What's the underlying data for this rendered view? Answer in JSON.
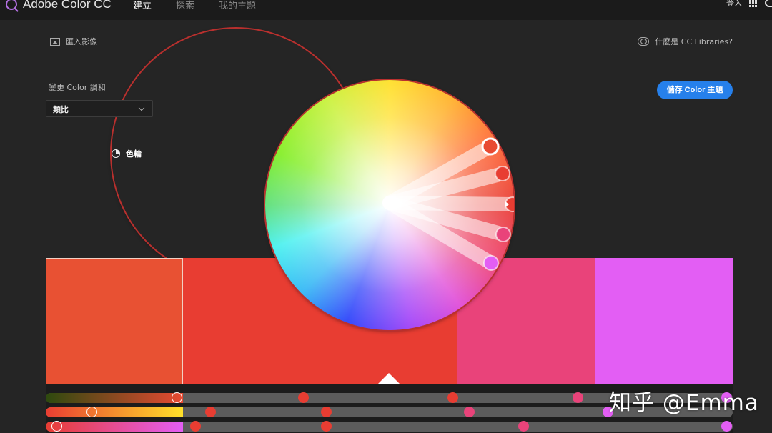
{
  "app": {
    "title": "Adobe Color CC"
  },
  "topnav": {
    "items": [
      "建立",
      "探索",
      "我的主題"
    ],
    "active": 0
  },
  "topright": {
    "login": "登入"
  },
  "subtabs": {
    "import_label": "匯入影像",
    "wheel_label": "色輪",
    "cc_libraries_label": "什麼是 CC Libraries?"
  },
  "harmony": {
    "label": "變更 Color 調和",
    "selected": "類比"
  },
  "save_button": {
    "label": "儲存 Color 主題"
  },
  "palette": {
    "colors": [
      "#e85133",
      "#e83d32",
      "#e9437a",
      "#e35ef4"
    ],
    "selected_index": 0
  },
  "wheel_markers": [
    {
      "color": "#e84a32",
      "selected": true
    },
    {
      "color": "#e83d32",
      "selected": false
    },
    {
      "color": "#e83d32",
      "selected": false,
      "base": true
    },
    {
      "color": "#e9437a",
      "selected": false
    },
    {
      "color": "#e35ef4",
      "selected": false
    }
  ],
  "sliders": [
    {
      "gradient": [
        "#2d4a0e",
        "#e84a32"
      ],
      "markers": [
        {
          "value": 0.19,
          "color": "#e84a32",
          "ring": true
        },
        {
          "value": 0.375,
          "color": "#e83d32"
        },
        {
          "value": 0.592,
          "color": "#e83d32"
        },
        {
          "value": 0.774,
          "color": "#e9437a"
        },
        {
          "value": 0.991,
          "color": "#e35ef4"
        }
      ]
    },
    {
      "gradient": [
        "#e83d32",
        "#ffe02a"
      ],
      "markers": [
        {
          "value": 0.067,
          "color": "#e84a32",
          "ring": true
        },
        {
          "value": 0.239,
          "color": "#e83d32"
        },
        {
          "value": 0.408,
          "color": "#e83d32"
        },
        {
          "value": 0.616,
          "color": "#e9437a"
        },
        {
          "value": 0.818,
          "color": "#e35ef4"
        }
      ]
    },
    {
      "gradient": [
        "#e83d32",
        "#e35ef4"
      ],
      "markers": [
        {
          "value": 0.016,
          "color": "#e84a32",
          "ring": true
        },
        {
          "value": 0.218,
          "color": "#e83d32"
        },
        {
          "value": 0.408,
          "color": "#e83d32"
        },
        {
          "value": 0.695,
          "color": "#e9437a"
        },
        {
          "value": 0.991,
          "color": "#e35ef4"
        }
      ]
    }
  ],
  "watermark": {
    "text": "知乎 @Emma"
  }
}
